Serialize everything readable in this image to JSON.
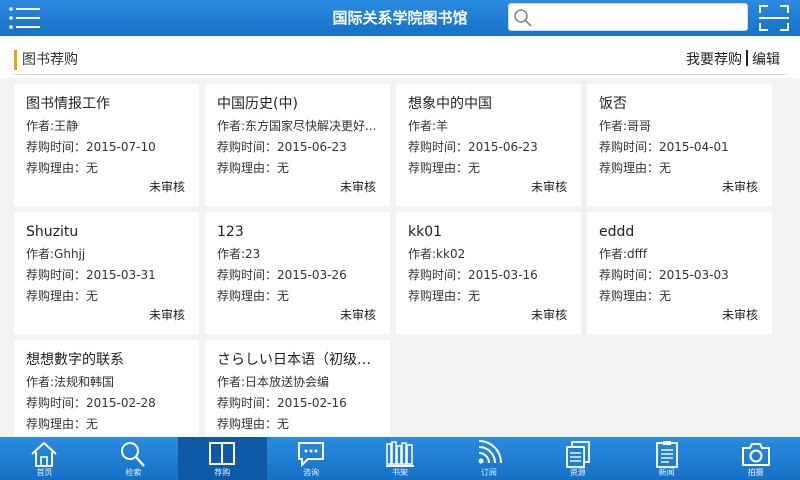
{
  "header": {
    "title": "国际关系学院图书馆",
    "search_placeholder": "",
    "menu_icon": "menu-icon",
    "scan_icon": "scan-icon"
  },
  "section": {
    "title": "图书荐购",
    "recommend_label": "我要荐购",
    "edit_label": "编辑"
  },
  "cards": [
    {
      "title": "图书情报工作",
      "author": "作者:王静",
      "date": "荐购时间：2015-07-10",
      "reason": "荐购理由：无",
      "status": "未审核"
    },
    {
      "title": "中国历史(中)",
      "author": "作者:东方国家尽快解决更好...",
      "date": "荐购时间：2015-06-23",
      "reason": "荐购理由：无",
      "status": "未审核"
    },
    {
      "title": "想象中的中国",
      "author": "作者:羊",
      "date": "荐购时间：2015-06-23",
      "reason": "荐购理由：无",
      "status": "未审核"
    },
    {
      "title": "饭否",
      "author": "作者:哥哥",
      "date": "荐购时间：2015-04-01",
      "reason": "荐购理由：无",
      "status": "未审核"
    },
    {
      "title": "Shuzitu",
      "author": "作者:Ghhjj",
      "date": "荐购时间：2015-03-31",
      "reason": "荐购理由：无",
      "status": "未审核"
    },
    {
      "title": "123",
      "author": "作者:23",
      "date": "荐购时间：2015-03-26",
      "reason": "荐购理由：无",
      "status": "未审核"
    },
    {
      "title": "kk01",
      "author": "作者:kk02",
      "date": "荐购时间：2015-03-16",
      "reason": "荐购理由：无",
      "status": "未审核"
    },
    {
      "title": "eddd",
      "author": "作者:dfff",
      "date": "荐购时间：2015-03-03",
      "reason": "荐购理由：无",
      "status": "未审核"
    },
    {
      "title": "想想數字的联系",
      "author": "作者:法规和韩国",
      "date": "荐购时间：2015-02-28",
      "reason": "荐购理由：无",
      "status": ""
    },
    {
      "title": "さらしい日本语（初级日...",
      "author": "作者:日本放送协会编",
      "date": "荐购时间：2015-02-16",
      "reason": "荐购理由：无",
      "status": ""
    }
  ],
  "nav": [
    {
      "label": "首页",
      "icon": "home-icon"
    },
    {
      "label": "检索",
      "icon": "search-icon"
    },
    {
      "label": "荐购",
      "icon": "book-icon",
      "active": true
    },
    {
      "label": "咨询",
      "icon": "chat-icon"
    },
    {
      "label": "书架",
      "icon": "bookshelf-icon"
    },
    {
      "label": "订阅",
      "icon": "rss-icon"
    },
    {
      "label": "资源",
      "icon": "documents-icon"
    },
    {
      "label": "新闻",
      "icon": "news-icon"
    },
    {
      "label": "拍摄",
      "icon": "camera-icon"
    }
  ],
  "colors": {
    "header_blue": "#1a7fd6",
    "active_nav": "#0f5aa7",
    "accent_orange": "#e0a530"
  }
}
